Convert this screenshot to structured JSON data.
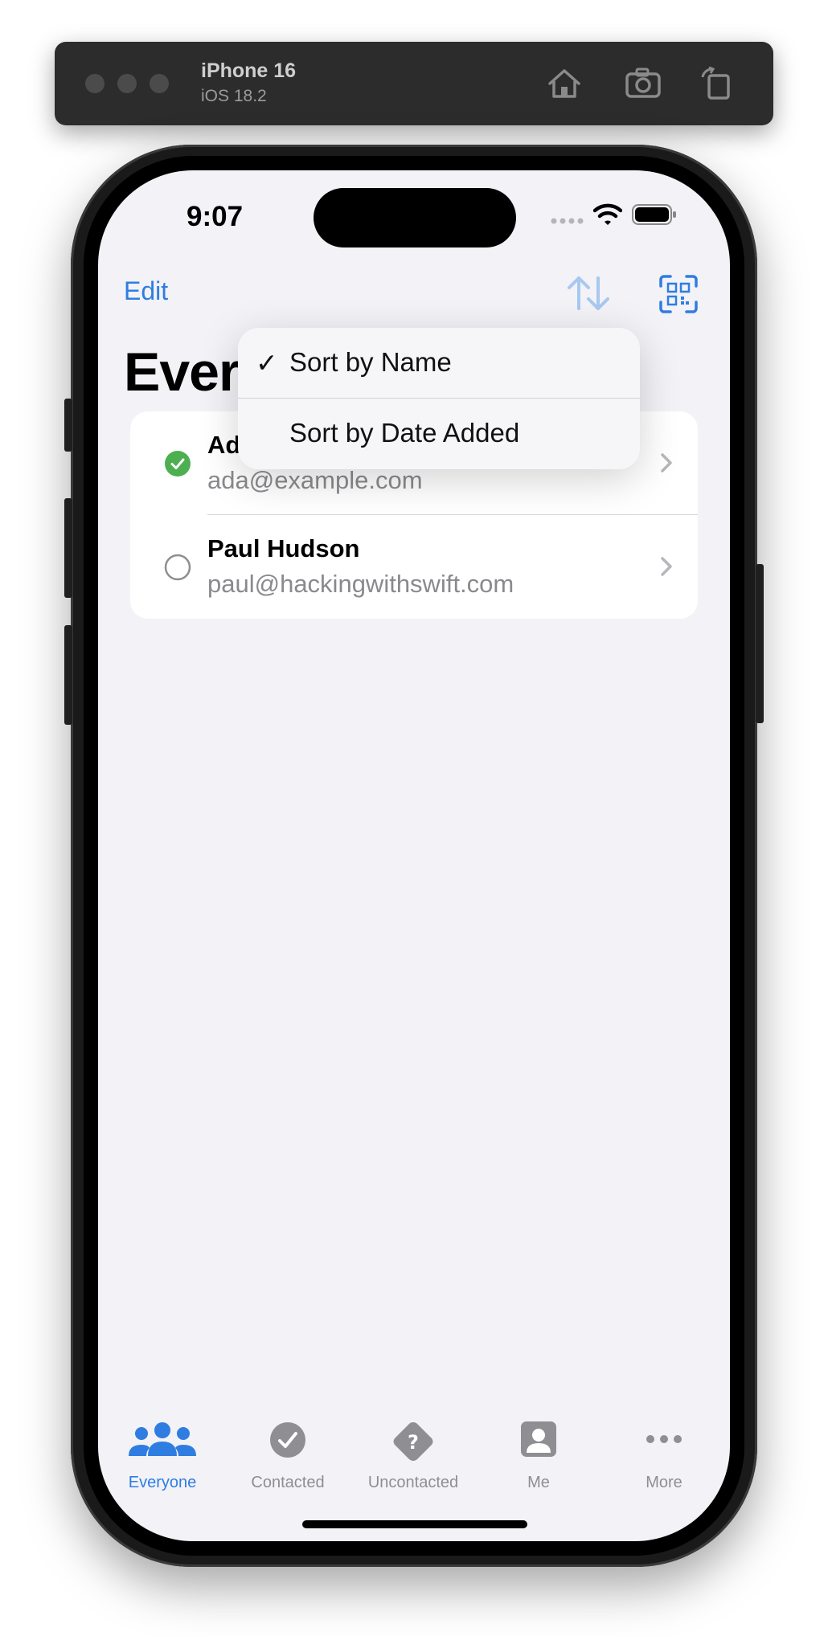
{
  "simulator": {
    "device_name": "iPhone 16",
    "os_version": "iOS 18.2"
  },
  "status_bar": {
    "time": "9:07"
  },
  "nav": {
    "edit_label": "Edit",
    "title": "Ever"
  },
  "people": [
    {
      "name": "Ad",
      "email": "ada@example.com",
      "contacted": true
    },
    {
      "name": "Paul Hudson",
      "email": "paul@hackingwithswift.com",
      "contacted": false
    }
  ],
  "sort_menu": {
    "items": [
      {
        "label": "Sort by Name",
        "checked": true,
        "check_glyph": "✓"
      },
      {
        "label": "Sort by Date Added",
        "checked": false
      }
    ]
  },
  "tabs": [
    {
      "label": "Everyone",
      "icon": "people-icon",
      "active": true
    },
    {
      "label": "Contacted",
      "icon": "checkmark-circle-icon",
      "active": false
    },
    {
      "label": "Uncontacted",
      "icon": "question-diamond-icon",
      "active": false
    },
    {
      "label": "Me",
      "icon": "person-square-icon",
      "active": false
    },
    {
      "label": "More",
      "icon": "ellipsis-icon",
      "active": false
    }
  ],
  "colors": {
    "accent": "#2f7de1",
    "contacted_green": "#4caf50",
    "inactive_tab": "#8e8e93",
    "screen_bg": "#f2f2f7"
  }
}
